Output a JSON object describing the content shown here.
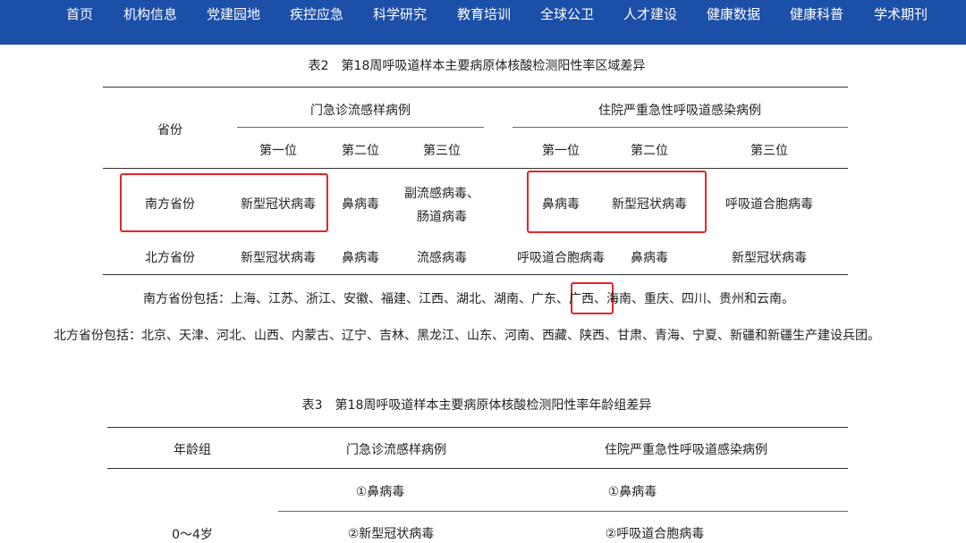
{
  "nav": [
    "首页",
    "机构信息",
    "党建园地",
    "疾控应急",
    "科学研究",
    "教育培训",
    "全球公卫",
    "人才建设",
    "健康数据",
    "健康科普",
    "学术期刊"
  ],
  "table2": {
    "caption": "表2　第18周呼吸道样本主要病原体核酸检测阳性率区域差异",
    "col_province": "省份",
    "group_outpatient": "门急诊流感样病例",
    "group_inpatient": "住院严重急性呼吸道感染病例",
    "rank1": "第一位",
    "rank2": "第二位",
    "rank3": "第三位",
    "rows": [
      {
        "region": "南方省份",
        "out1": "新型冠状病毒",
        "out2": "鼻病毒",
        "out3_line1": "副流感病毒、",
        "out3_line2": "肠道病毒",
        "in1": "鼻病毒",
        "in2": "新型冠状病毒",
        "in3": "呼吸道合胞病毒"
      },
      {
        "region": "北方省份",
        "out1": "新型冠状病毒",
        "out2": "鼻病毒",
        "out3": "流感病毒",
        "in1": "呼吸道合胞病毒",
        "in2": "鼻病毒",
        "in3": "新型冠状病毒"
      }
    ],
    "south_note_prefix": "南方省份包括：上海、江苏、浙江、安徽、福建、江西、湖北、湖南、广东、",
    "south_note_highlight": "广西",
    "south_note_suffix": "、海南、重庆、四川、贵州和云南。",
    "north_note": "北方省份包括：北京、天津、河北、山西、内蒙古、辽宁、吉林、黑龙江、山东、河南、西藏、陕西、甘肃、青海、宁夏、新疆和新疆生产建设兵团。"
  },
  "table3": {
    "caption": "表3　第18周呼吸道样本主要病原体核酸检测阳性率年龄组差异",
    "col_age": "年龄组",
    "col_outpatient": "门急诊流感样病例",
    "col_inpatient": "住院严重急性呼吸道感染病例",
    "age_group": "0～4岁",
    "out_row1": "①鼻病毒",
    "in_row1": "①鼻病毒",
    "out_row2": "②新型冠状病毒",
    "in_row2": "②呼吸道合胞病毒"
  },
  "colors": {
    "nav_bg": "#1c4fa8",
    "highlight_box": "#e0272b"
  }
}
